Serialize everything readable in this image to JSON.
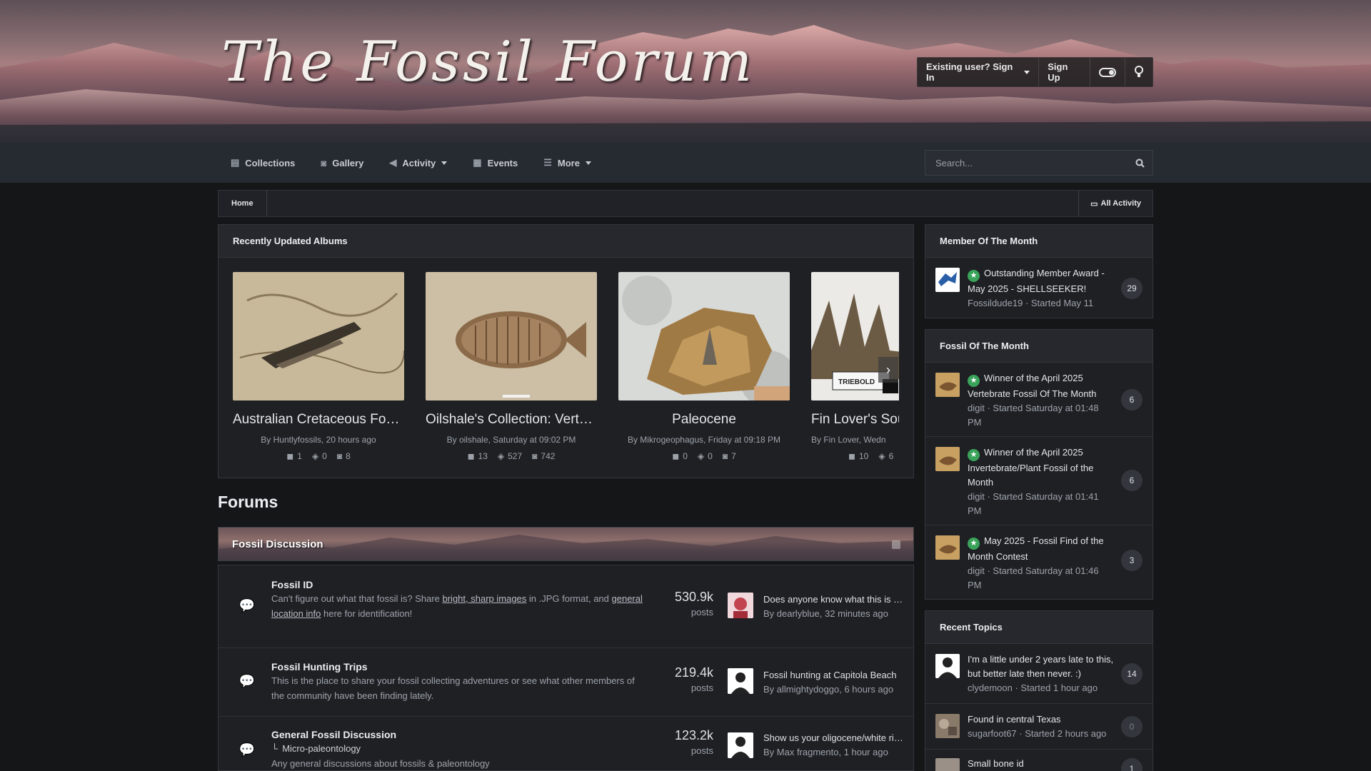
{
  "header": {
    "logo_text": "The Fossil Forum",
    "sign_in": "Existing user? Sign In",
    "sign_up": "Sign Up"
  },
  "nav": {
    "items": [
      {
        "label": "Collections",
        "icon": "document-icon"
      },
      {
        "label": "Gallery",
        "icon": "camera-icon"
      },
      {
        "label": "Activity",
        "icon": "megaphone-icon"
      },
      {
        "label": "Events",
        "icon": "calendar-icon"
      },
      {
        "label": "More",
        "icon": "list-icon"
      }
    ],
    "search_placeholder": "Search..."
  },
  "breadcrumb": {
    "home": "Home",
    "all_activity": "All Activity"
  },
  "albums": {
    "title": "Recently Updated Albums",
    "items": [
      {
        "title": "Australian Cretaceous Fossils",
        "by": "By Huntlyfossils, 20 hours ago",
        "comments": "1",
        "reviews": "0",
        "images": "8"
      },
      {
        "title": "Oilshale's Collection: Verte…",
        "by": "By oilshale, Saturday at 09:02 PM",
        "comments": "13",
        "reviews": "527",
        "images": "742"
      },
      {
        "title": "Paleocene",
        "by": "By Mikrogeophagus, Friday at 09:18 PM",
        "comments": "0",
        "reviews": "0",
        "images": "7"
      },
      {
        "title": "Fin Lover's Sou",
        "by": "By Fin Lover, Wedn",
        "comments": "10",
        "reviews": "6",
        "images": ""
      }
    ]
  },
  "forums": {
    "heading": "Forums",
    "category": "Fossil Discussion",
    "rows": [
      {
        "name": "Fossil ID",
        "desc_pre": "Can't figure out what that fossil is? Share ",
        "desc_link1": "bright, sharp images",
        "desc_mid": " in .JPG format, and ",
        "desc_link2": "general location info",
        "desc_post": " here for identification!",
        "count": "530.9k",
        "count_label": "posts",
        "last_title": "Does anyone know what this is …",
        "last_by": "By dearlyblue, 32 minutes ago"
      },
      {
        "name": "Fossil Hunting Trips",
        "desc": "This is the place to share your fossil collecting adventures or see what other members of the community have been finding lately.",
        "count": "219.4k",
        "count_label": "posts",
        "last_title": "Fossil hunting at Capitola Beach",
        "last_by": "By allmightydoggo, 6 hours ago"
      },
      {
        "name": "General Fossil Discussion",
        "sub": "Micro-paleontology",
        "desc": "Any general discussions about fossils & paleontology",
        "count": "123.2k",
        "count_label": "posts",
        "last_title": "Show us your oligocene/white ri…",
        "last_by": "By Max fragmento, 1 hour ago"
      }
    ]
  },
  "sidebar": {
    "member_of_month": {
      "title": "Member Of The Month",
      "items": [
        {
          "title": "Outstanding Member Award - May 2025 - SHELLSEEKER!",
          "meta": "Fossildude19 · Started May 11",
          "count": "29"
        }
      ]
    },
    "fossil_of_month": {
      "title": "Fossil Of The Month",
      "items": [
        {
          "title": "Winner of the April 2025 Vertebrate Fossil Of The Month",
          "meta": "digit · Started Saturday at 01:48 PM",
          "count": "6"
        },
        {
          "title": "Winner of the April 2025 Invertebrate/Plant Fossil of the Month",
          "meta": "digit · Started Saturday at 01:41 PM",
          "count": "6"
        },
        {
          "title": "May 2025 - Fossil Find of the Month Contest",
          "meta": "digit · Started Saturday at 01:46 PM",
          "count": "3"
        }
      ]
    },
    "recent_topics": {
      "title": "Recent Topics",
      "items": [
        {
          "title": "I'm a little under 2 years late to this, but better late then never. :)",
          "meta": "clydemoon · Started 1 hour ago",
          "count": "14"
        },
        {
          "title": "Found in central Texas",
          "meta": "sugarfoot67 · Started 2 hours ago",
          "count": "0"
        },
        {
          "title": "Small bone id",
          "meta": "",
          "count": "1"
        }
      ]
    }
  },
  "colors": {
    "page_bg": "#151618",
    "panel_bg": "#1e2024",
    "accent_green": "#3aa35a"
  }
}
